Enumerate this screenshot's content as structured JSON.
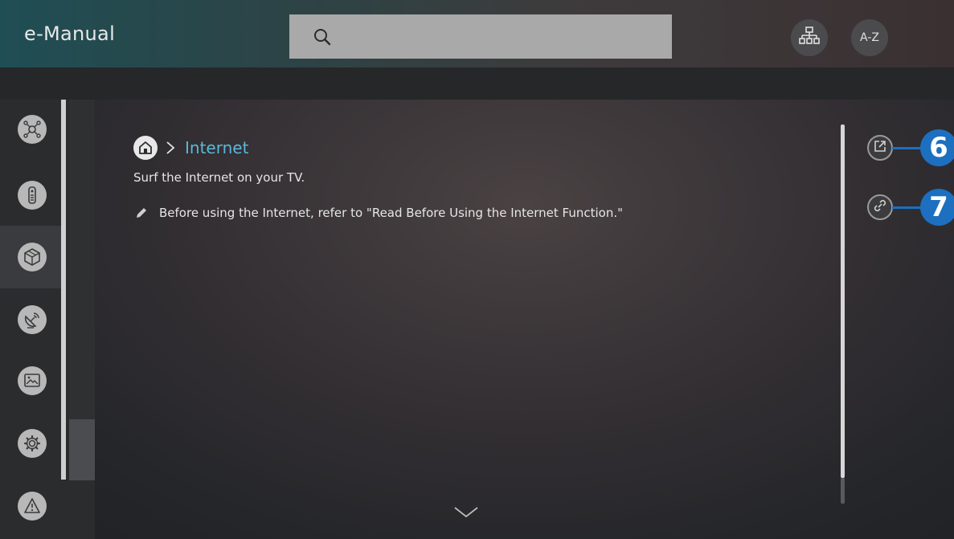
{
  "header": {
    "title": "e-Manual",
    "search": {
      "value": "",
      "placeholder": ""
    },
    "sitemap_icon": "sitemap-icon",
    "az_label": "A-Z"
  },
  "sidebar": {
    "items": [
      {
        "icon": "smart-features-icon",
        "active": false
      },
      {
        "icon": "remote-control-icon",
        "active": false
      },
      {
        "icon": "internet-globe-icon",
        "active": true
      },
      {
        "icon": "satellite-broadcast-icon",
        "active": false
      },
      {
        "icon": "picture-sound-icon",
        "active": false
      },
      {
        "icon": "settings-gear-icon",
        "active": false
      },
      {
        "icon": "troubleshooting-warning-icon",
        "active": false
      }
    ]
  },
  "content": {
    "breadcrumb": {
      "home_icon": "home-icon",
      "separator": ">",
      "current": "Internet"
    },
    "description": "Surf the Internet on your TV.",
    "note": "Before using the Internet, refer to \"Read Before Using the Internet Function.\""
  },
  "actions": [
    {
      "icon": "open-link-icon",
      "callout": "6"
    },
    {
      "icon": "related-link-icon",
      "callout": "7"
    }
  ],
  "colors": {
    "accent": "#5bb8d8",
    "callout": "#1d6fc0"
  }
}
